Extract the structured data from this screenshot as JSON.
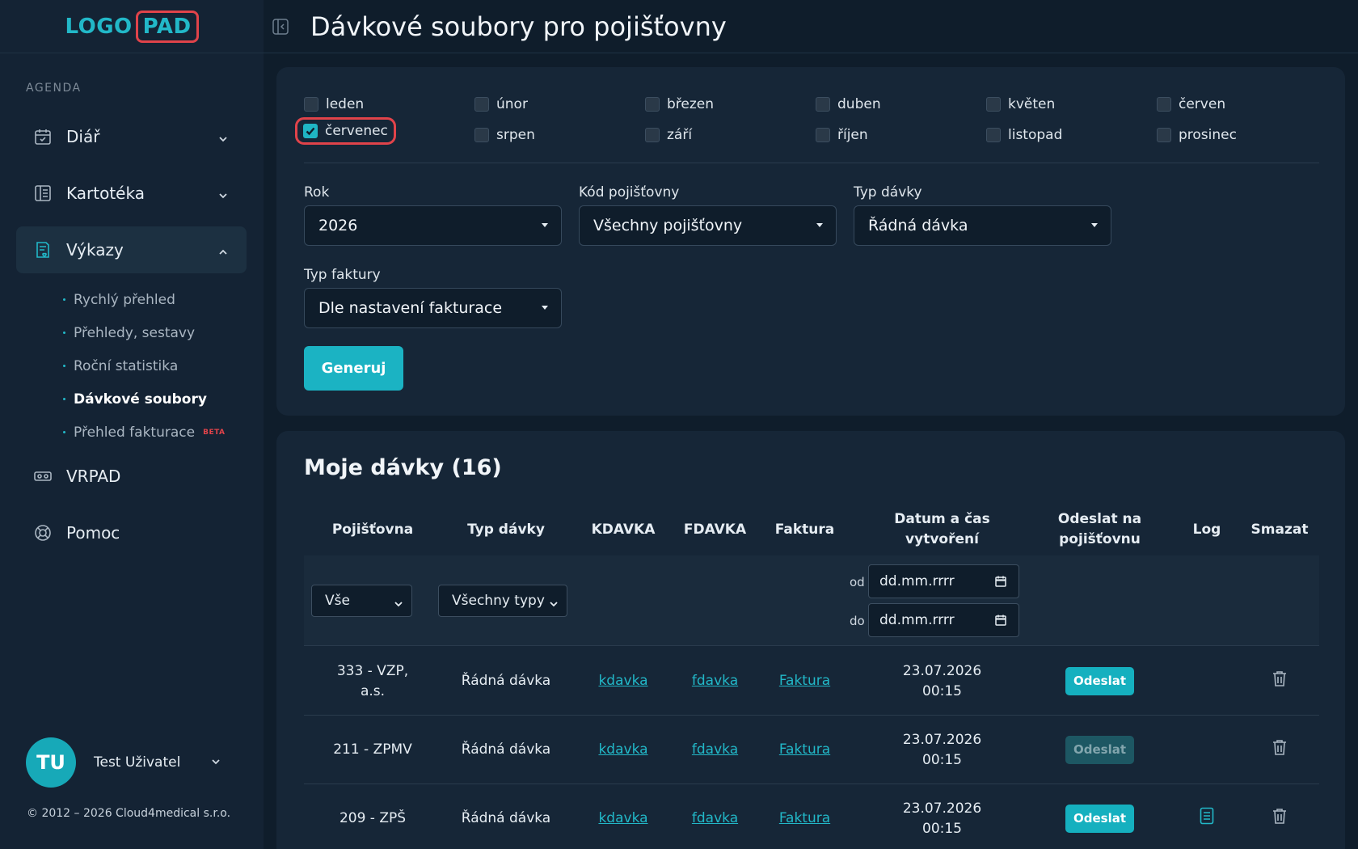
{
  "brand": {
    "logo_left": "LOGO",
    "logo_right": "PAD"
  },
  "sidebar": {
    "section_label": "AGENDA",
    "items": [
      {
        "label": "Diář",
        "icon": "calendar-icon"
      },
      {
        "label": "Kartotéka",
        "icon": "book-icon"
      },
      {
        "label": "Výkazy",
        "icon": "report-icon"
      },
      {
        "label": "VRPAD",
        "icon": "vr-headset-icon"
      },
      {
        "label": "Pomoc",
        "icon": "lifebuoy-icon"
      }
    ],
    "sub_items": [
      {
        "label": "Rychlý přehled"
      },
      {
        "label": "Přehledy, sestavy"
      },
      {
        "label": "Roční statistika"
      },
      {
        "label": "Dávkové soubory"
      },
      {
        "label": "Přehled fakturace",
        "badge": "BETA"
      }
    ],
    "user": {
      "initials": "TU",
      "name": "Test Uživatel"
    },
    "copyright": "© 2012 – 2026 Cloud4medical s.r.o."
  },
  "header": {
    "title": "Dávkové soubory pro pojišťovny"
  },
  "filters": {
    "months": [
      {
        "label": "leden",
        "checked": false
      },
      {
        "label": "únor",
        "checked": false
      },
      {
        "label": "březen",
        "checked": false
      },
      {
        "label": "duben",
        "checked": false
      },
      {
        "label": "květen",
        "checked": false
      },
      {
        "label": "červen",
        "checked": false
      },
      {
        "label": "červenec",
        "checked": true
      },
      {
        "label": "srpen",
        "checked": false
      },
      {
        "label": "září",
        "checked": false
      },
      {
        "label": "říjen",
        "checked": false
      },
      {
        "label": "listopad",
        "checked": false
      },
      {
        "label": "prosinec",
        "checked": false
      }
    ],
    "year": {
      "label": "Rok",
      "value": "2026"
    },
    "insurer_code": {
      "label": "Kód pojišťovny",
      "value": "Všechny pojišťovny"
    },
    "batch_type": {
      "label": "Typ dávky",
      "value": "Řádná dávka"
    },
    "invoice_type": {
      "label": "Typ faktury",
      "value": "Dle nastavení fakturace"
    },
    "generate_label": "Generuj"
  },
  "table": {
    "title": "Moje dávky (16)",
    "headers": {
      "insurer": "Pojišťovna",
      "type": "Typ dávky",
      "kdavka": "KDAVKA",
      "fdavka": "FDAVKA",
      "invoice": "Faktura",
      "created_1": "Datum a čas",
      "created_2": "vytvoření",
      "send_1": "Odeslat na",
      "send_2": "pojišťovnu",
      "log": "Log",
      "delete": "Smazat"
    },
    "filter_row": {
      "insurer_value": "Vše",
      "type_value": "Všechny typy",
      "from_label": "od",
      "to_label": "do",
      "date_placeholder": "dd.mm.rrrr"
    },
    "rows": [
      {
        "insurer_1": "333 - VZP,",
        "insurer_2": "a.s.",
        "type": "Řádná dávka",
        "kdavka": "kdavka",
        "fdavka": "fdavka",
        "invoice": "Faktura",
        "date": "23.07.2026",
        "time": "00:15",
        "send": "Odeslat",
        "send_enabled": true,
        "has_log": false
      },
      {
        "insurer_1": "211 - ZPMV",
        "insurer_2": "",
        "type": "Řádná dávka",
        "kdavka": "kdavka",
        "fdavka": "fdavka",
        "invoice": "Faktura",
        "date": "23.07.2026",
        "time": "00:15",
        "send": "Odeslat",
        "send_enabled": false,
        "has_log": false
      },
      {
        "insurer_1": "209 - ZPŠ",
        "insurer_2": "",
        "type": "Řádná dávka",
        "kdavka": "kdavka",
        "fdavka": "fdavka",
        "invoice": "Faktura",
        "date": "23.07.2026",
        "time": "00:15",
        "send": "Odeslat",
        "send_enabled": true,
        "has_log": true
      }
    ]
  },
  "colors": {
    "accent": "#1bb3c3",
    "highlight": "#e0434a",
    "background": "#0f1d2b"
  }
}
